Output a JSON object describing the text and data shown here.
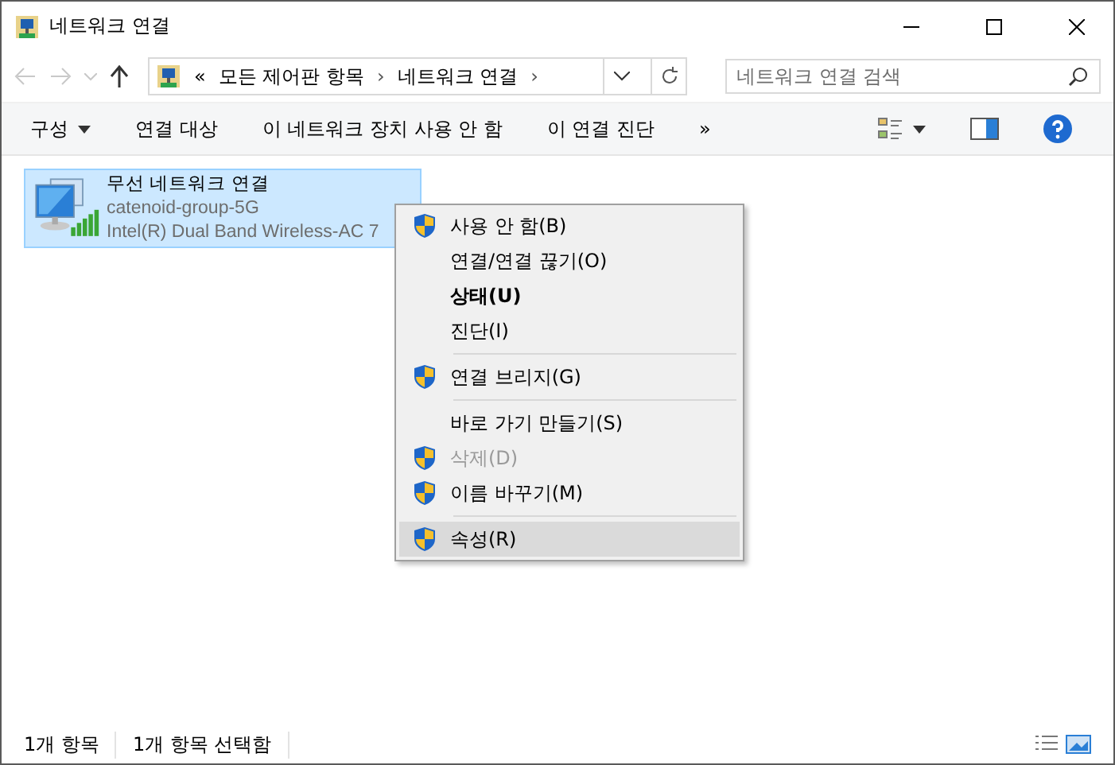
{
  "window": {
    "title": "네트워크 연결"
  },
  "address": {
    "prefix": "«",
    "crumbs": [
      "모든 제어판 항목",
      "네트워크 연결"
    ],
    "separator": "›"
  },
  "search": {
    "placeholder": "네트워크 연결 검색"
  },
  "commands": [
    "구성",
    "연결 대상",
    "이 네트워크 장치 사용 안 함",
    "이 연결 진단"
  ],
  "more": "»",
  "connection": {
    "name": "무선 네트워크 연결",
    "ssid": "catenoid-group-5G",
    "adapter": "Intel(R) Dual Band Wireless-AC 7",
    "selected": true
  },
  "menu": [
    {
      "kind": "item",
      "label": "사용 안 함(B)",
      "shield": true,
      "bold": false,
      "disabled": false,
      "selected": false
    },
    {
      "kind": "item",
      "label": "연결/연결 끊기(O)",
      "shield": false,
      "bold": false,
      "disabled": false,
      "selected": false
    },
    {
      "kind": "item",
      "label": "상태(U)",
      "shield": false,
      "bold": true,
      "disabled": false,
      "selected": false
    },
    {
      "kind": "item",
      "label": "진단(I)",
      "shield": false,
      "bold": false,
      "disabled": false,
      "selected": false
    },
    {
      "kind": "separator"
    },
    {
      "kind": "item",
      "label": "연결 브리지(G)",
      "shield": true,
      "bold": false,
      "disabled": false,
      "selected": false
    },
    {
      "kind": "separator"
    },
    {
      "kind": "item",
      "label": "바로 가기 만들기(S)",
      "shield": false,
      "bold": false,
      "disabled": false,
      "selected": false
    },
    {
      "kind": "item",
      "label": "삭제(D)",
      "shield": true,
      "bold": false,
      "disabled": true,
      "selected": false
    },
    {
      "kind": "item",
      "label": "이름 바꾸기(M)",
      "shield": true,
      "bold": false,
      "disabled": false,
      "selected": false
    },
    {
      "kind": "separator"
    },
    {
      "kind": "item",
      "label": "속성(R)",
      "shield": true,
      "bold": false,
      "disabled": false,
      "selected": true
    }
  ],
  "status_bar": [
    "1개 항목",
    "1개 항목 선택함"
  ]
}
